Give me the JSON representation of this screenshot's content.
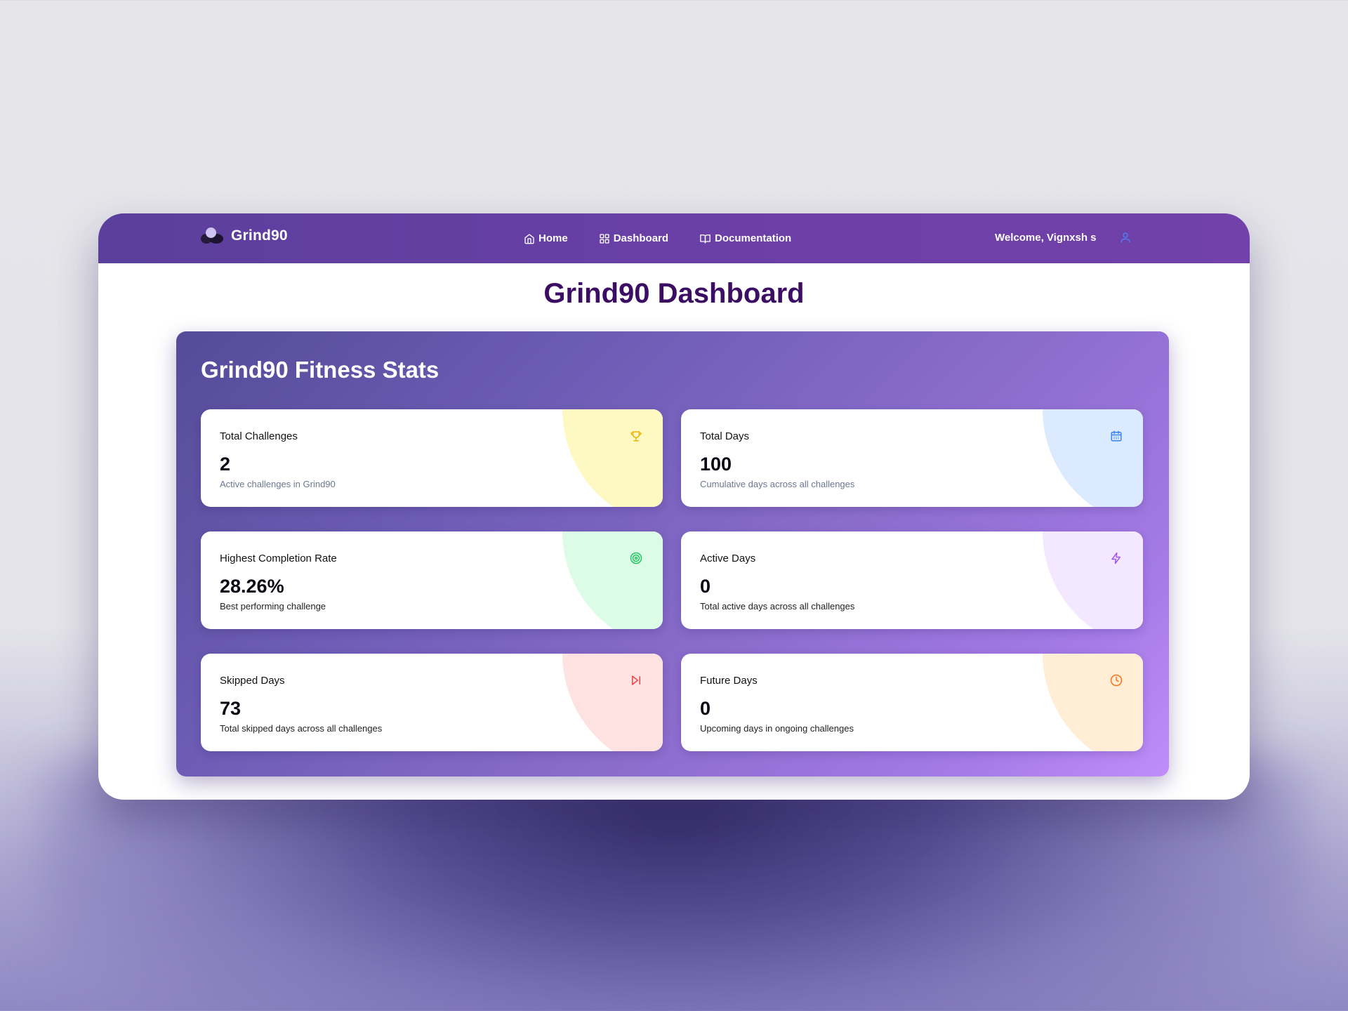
{
  "navbar": {
    "brand": "Grind90",
    "links": [
      {
        "label": "Home",
        "icon": "home-icon"
      },
      {
        "label": "Dashboard",
        "icon": "grid-icon"
      },
      {
        "label": "Documentation",
        "icon": "book-icon"
      }
    ],
    "welcome": "Welcome, Vignxsh s",
    "user_icon": "user-icon"
  },
  "main": {
    "title": "Grind90 Dashboard",
    "panel_title": "Grind90 Fitness Stats",
    "cards": [
      {
        "label": "Total Challenges",
        "value": "2",
        "description": "Active challenges in Grind90",
        "icon": "trophy-icon",
        "icon_color": "#eab308",
        "accent": "#fef9c3",
        "desc_color": "#6b7890"
      },
      {
        "label": "Total Days",
        "value": "100",
        "description": "Cumulative days across all challenges",
        "icon": "calendar-icon",
        "icon_color": "#3b82f6",
        "accent": "#dbeafe",
        "desc_color": "#6b7890"
      },
      {
        "label": "Highest Completion Rate",
        "value": "28.26%",
        "description": "Best performing challenge",
        "icon": "target-icon",
        "icon_color": "#22c55e",
        "accent": "#dcfce7",
        "desc_color": "#222222"
      },
      {
        "label": "Active Days",
        "value": "0",
        "description": "Total active days across all challenges",
        "icon": "zap-icon",
        "icon_color": "#a855f7",
        "accent": "#f3e8ff",
        "desc_color": "#222222"
      },
      {
        "label": "Skipped Days",
        "value": "73",
        "description": "Total skipped days across all challenges",
        "icon": "skip-forward-icon",
        "icon_color": "#ef4444",
        "accent": "#fee2e2",
        "desc_color": "#222222"
      },
      {
        "label": "Future Days",
        "value": "0",
        "description": "Upcoming days in ongoing challenges",
        "icon": "clock-icon",
        "icon_color": "#f97316",
        "accent": "#ffedd5",
        "desc_color": "#222222"
      }
    ]
  }
}
